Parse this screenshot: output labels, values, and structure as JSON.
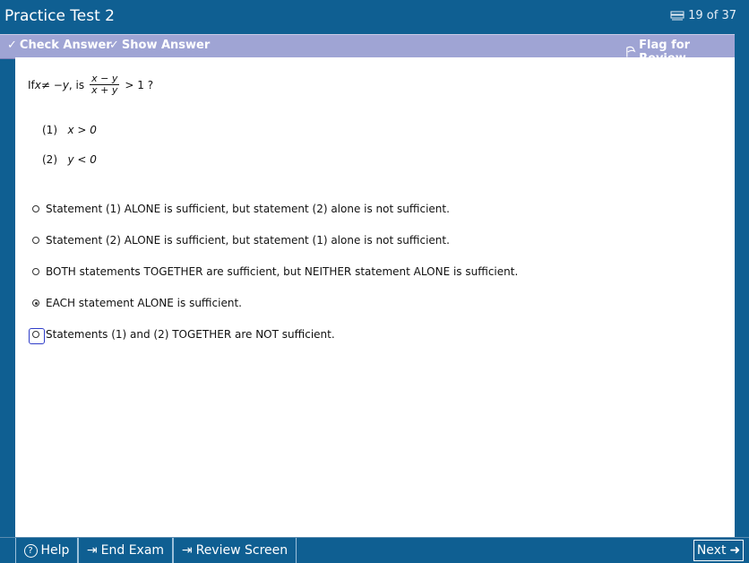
{
  "window": {
    "title": "Practice Test 2",
    "progress_text": "19 of 37"
  },
  "toolbar": {
    "check_answer": "Check Answer",
    "show_answer": "Show Answer",
    "flag_for_review": "Flag for Review"
  },
  "question": {
    "prefix": "If ",
    "x": "x",
    "neq": " ≠ −",
    "y": "y",
    "is": ", is",
    "numerator": "x − y",
    "denominator": "x + y",
    "suffix": "> 1 ?",
    "statements": [
      {
        "num": "(1)",
        "expr": "x > 0"
      },
      {
        "num": "(2)",
        "expr": "y < 0"
      }
    ]
  },
  "choices": [
    {
      "label": "Statement (1) ALONE is sufficient, but statement (2) alone is not sufficient.",
      "selected": false
    },
    {
      "label": "Statement (2) ALONE is sufficient, but statement (1) alone is not sufficient.",
      "selected": false
    },
    {
      "label": "BOTH statements TOGETHER are sufficient, but NEITHER statement ALONE is sufficient.",
      "selected": false
    },
    {
      "label": "EACH statement ALONE is sufficient.",
      "selected": true
    },
    {
      "label": "Statements (1) and (2) TOGETHER are NOT sufficient.",
      "selected": false
    }
  ],
  "bottom": {
    "help": "Help",
    "end_exam": "End Exam",
    "review_screen": "Review Screen",
    "next": "Next"
  },
  "icons": {
    "progress": "document-stack-icon",
    "check": "check-answer-icon",
    "show": "show-answer-icon",
    "flag": "flag-icon",
    "help": "help-circle-icon",
    "end": "end-exam-icon",
    "review": "review-screen-icon",
    "next": "arrow-right-icon"
  }
}
